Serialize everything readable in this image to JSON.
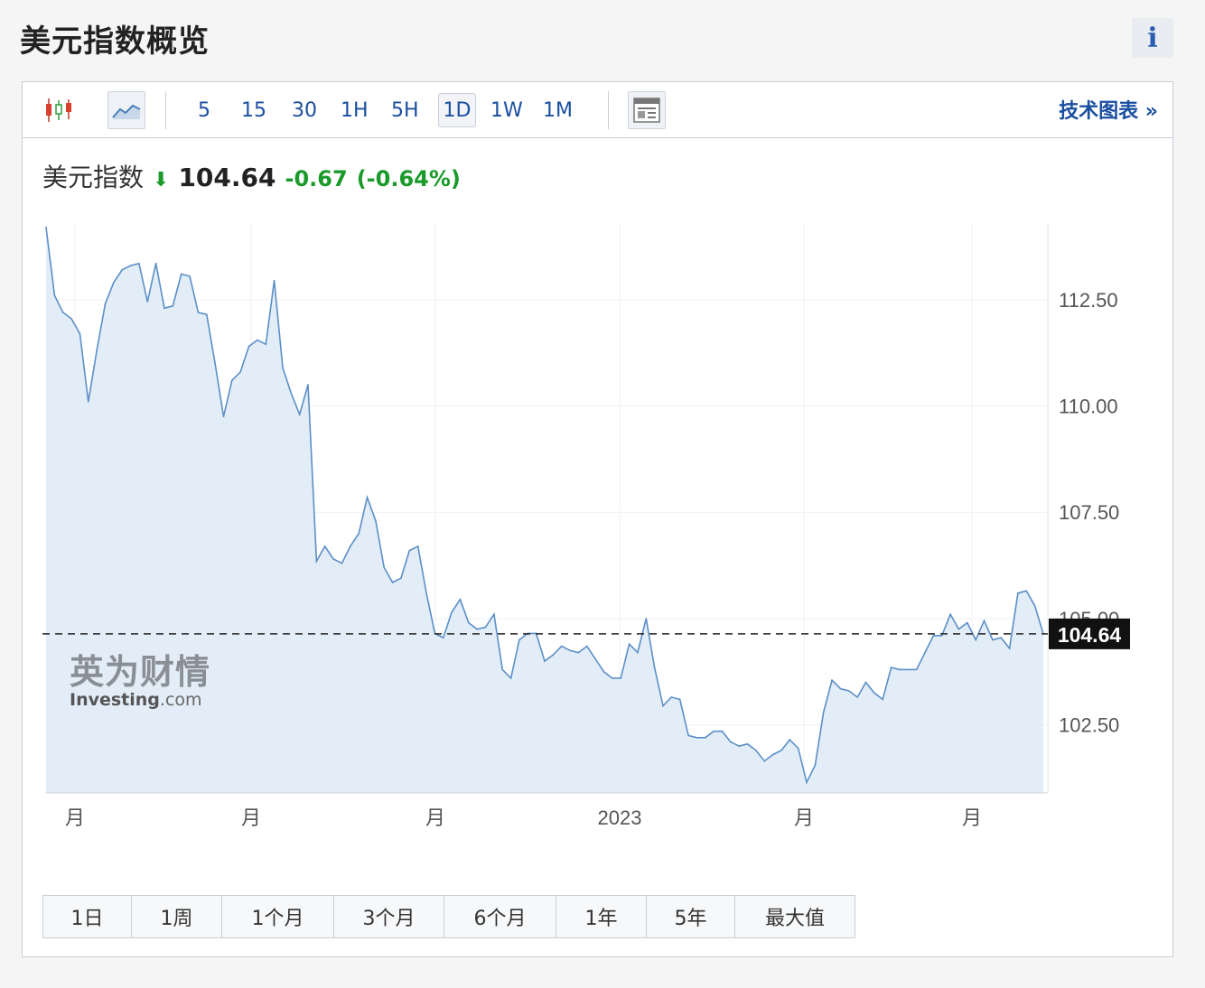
{
  "page": {
    "title": "美元指数概览",
    "info_label": "i"
  },
  "toolbar": {
    "intervals": [
      "5",
      "15",
      "30",
      "1H",
      "5H",
      "1D",
      "1W",
      "1M"
    ],
    "active_interval": "1D",
    "tech_chart_link": "技术图表 »"
  },
  "quote": {
    "name": "美元指数",
    "price": "104.64",
    "change": "-0.67",
    "change_pct": "(-0.64%)",
    "direction": "down",
    "color_down": "#1a9a2a"
  },
  "watermark": {
    "cn": "英为财情",
    "en": "Investing",
    "en_suffix": ".com"
  },
  "range_buttons": [
    "1日",
    "1周",
    "1个月",
    "3个月",
    "6个月",
    "1年",
    "5年",
    "最大值"
  ],
  "chart_data": {
    "type": "area",
    "title": "",
    "xlabel": "",
    "ylabel": "",
    "ylim": [
      100.9,
      114.3
    ],
    "y_ticks": [
      "112.50",
      "110.00",
      "107.50",
      "105.00",
      "102.50"
    ],
    "x_tick_labels": [
      "月",
      "月",
      "月",
      "2023",
      "月",
      "月"
    ],
    "current_value_label": "104.64",
    "current_value": 104.64,
    "grid": true,
    "line_color": "#5b8fc7",
    "fill_color": "#e3edf7",
    "series": [
      {
        "values": [
          114.2,
          112.6,
          112.2,
          112.05,
          111.7,
          110.1,
          111.3,
          112.4,
          112.9,
          113.2,
          113.3,
          113.35,
          112.45,
          113.35,
          112.3,
          112.35,
          113.1,
          113.05,
          112.2,
          112.15,
          111.0,
          109.75,
          110.6,
          110.8,
          111.4,
          111.55,
          111.45,
          112.95,
          110.9,
          110.3,
          109.8,
          110.5,
          106.35,
          106.7,
          106.4,
          106.3,
          106.7,
          107.0,
          107.85,
          107.3,
          106.2,
          105.85,
          105.95,
          106.6,
          106.7,
          105.6,
          104.65,
          104.55,
          105.15,
          105.45,
          104.9,
          104.75,
          104.8,
          105.1,
          103.8,
          103.6,
          104.5,
          104.65,
          104.65,
          104.0,
          104.15,
          104.35,
          104.25,
          104.2,
          104.35,
          104.05,
          103.75,
          103.6,
          103.6,
          104.4,
          104.2,
          105.0,
          103.85,
          102.95,
          103.15,
          103.1,
          102.25,
          102.2,
          102.2,
          102.35,
          102.35,
          102.1,
          102.0,
          102.05,
          101.9,
          101.65,
          101.8,
          101.9,
          102.15,
          101.95,
          101.15,
          101.55,
          102.8,
          103.55,
          103.35,
          103.3,
          103.15,
          103.5,
          103.25,
          103.1,
          103.85,
          103.8,
          103.8,
          103.8,
          104.2,
          104.6,
          104.6,
          105.1,
          104.75,
          104.9,
          104.5,
          104.95,
          104.5,
          104.55,
          104.3,
          105.6,
          105.65,
          105.3,
          104.64
        ]
      }
    ]
  }
}
